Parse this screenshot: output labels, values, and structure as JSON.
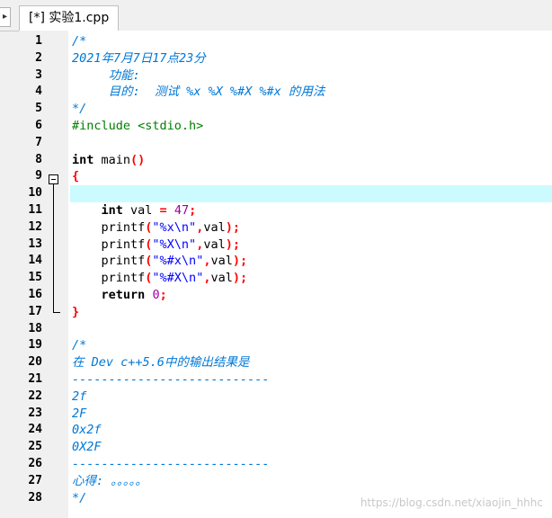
{
  "tab": {
    "scroll_left_icon": "arrow-right-icon",
    "title": "[*] 实验1.cpp"
  },
  "editor": {
    "active_line": 10,
    "lines": [
      {
        "n": "1",
        "segs": [
          {
            "t": "/*",
            "c": "comment"
          }
        ]
      },
      {
        "n": "2",
        "segs": [
          {
            "t": "2021年7月7日17点23分",
            "c": "comment"
          }
        ]
      },
      {
        "n": "3",
        "segs": [
          {
            "t": "     功能:",
            "c": "comment"
          }
        ]
      },
      {
        "n": "4",
        "segs": [
          {
            "t": "     目的:  测试 %x %X %#X %#x 的用法",
            "c": "comment"
          }
        ]
      },
      {
        "n": "5",
        "segs": [
          {
            "t": "*/",
            "c": "comment"
          }
        ]
      },
      {
        "n": "6",
        "segs": [
          {
            "t": "#include <stdio.h>",
            "c": "pre"
          }
        ]
      },
      {
        "n": "7",
        "segs": []
      },
      {
        "n": "8",
        "segs": [
          {
            "t": "int",
            "c": "kw"
          },
          {
            "t": " main",
            "c": "plain"
          },
          {
            "t": "()",
            "c": "sym"
          }
        ]
      },
      {
        "n": "9",
        "segs": [
          {
            "t": "{",
            "c": "sym"
          }
        ]
      },
      {
        "n": "10",
        "segs": []
      },
      {
        "n": "11",
        "segs": [
          {
            "t": "    ",
            "c": "plain"
          },
          {
            "t": "int",
            "c": "kw"
          },
          {
            "t": " val ",
            "c": "plain"
          },
          {
            "t": "=",
            "c": "sym"
          },
          {
            "t": " ",
            "c": "plain"
          },
          {
            "t": "47",
            "c": "num"
          },
          {
            "t": ";",
            "c": "sym"
          }
        ]
      },
      {
        "n": "12",
        "segs": [
          {
            "t": "    printf",
            "c": "plain"
          },
          {
            "t": "(",
            "c": "sym"
          },
          {
            "t": "\"%x\\n\"",
            "c": "str"
          },
          {
            "t": ",",
            "c": "sym"
          },
          {
            "t": "val",
            "c": "plain"
          },
          {
            "t": ");",
            "c": "sym"
          }
        ]
      },
      {
        "n": "13",
        "segs": [
          {
            "t": "    printf",
            "c": "plain"
          },
          {
            "t": "(",
            "c": "sym"
          },
          {
            "t": "\"%X\\n\"",
            "c": "str"
          },
          {
            "t": ",",
            "c": "sym"
          },
          {
            "t": "val",
            "c": "plain"
          },
          {
            "t": ");",
            "c": "sym"
          }
        ]
      },
      {
        "n": "14",
        "segs": [
          {
            "t": "    printf",
            "c": "plain"
          },
          {
            "t": "(",
            "c": "sym"
          },
          {
            "t": "\"%#x\\n\"",
            "c": "str"
          },
          {
            "t": ",",
            "c": "sym"
          },
          {
            "t": "val",
            "c": "plain"
          },
          {
            "t": ");",
            "c": "sym"
          }
        ]
      },
      {
        "n": "15",
        "segs": [
          {
            "t": "    printf",
            "c": "plain"
          },
          {
            "t": "(",
            "c": "sym"
          },
          {
            "t": "\"%#X\\n\"",
            "c": "str"
          },
          {
            "t": ",",
            "c": "sym"
          },
          {
            "t": "val",
            "c": "plain"
          },
          {
            "t": ");",
            "c": "sym"
          }
        ]
      },
      {
        "n": "16",
        "segs": [
          {
            "t": "    ",
            "c": "plain"
          },
          {
            "t": "return",
            "c": "kw"
          },
          {
            "t": " ",
            "c": "plain"
          },
          {
            "t": "0",
            "c": "num"
          },
          {
            "t": ";",
            "c": "sym"
          }
        ]
      },
      {
        "n": "17",
        "segs": [
          {
            "t": "}",
            "c": "sym"
          }
        ]
      },
      {
        "n": "18",
        "segs": []
      },
      {
        "n": "19",
        "segs": [
          {
            "t": "/*",
            "c": "comment"
          }
        ]
      },
      {
        "n": "20",
        "segs": [
          {
            "t": "在 Dev c++5.6中的输出结果是",
            "c": "comment"
          }
        ]
      },
      {
        "n": "21",
        "segs": [
          {
            "t": "---------------------------",
            "c": "comment"
          }
        ]
      },
      {
        "n": "22",
        "segs": [
          {
            "t": "2f",
            "c": "comment"
          }
        ]
      },
      {
        "n": "23",
        "segs": [
          {
            "t": "2F",
            "c": "comment"
          }
        ]
      },
      {
        "n": "24",
        "segs": [
          {
            "t": "0x2f",
            "c": "comment"
          }
        ]
      },
      {
        "n": "25",
        "segs": [
          {
            "t": "0X2F",
            "c": "comment"
          }
        ]
      },
      {
        "n": "26",
        "segs": [
          {
            "t": "---------------------------",
            "c": "comment"
          }
        ]
      },
      {
        "n": "27",
        "segs": [
          {
            "t": "心得: 。。。。。",
            "c": "comment"
          }
        ]
      },
      {
        "n": "28",
        "segs": [
          {
            "t": "*/",
            "c": "comment"
          }
        ]
      }
    ]
  },
  "watermark": "https://blog.csdn.net/xiaojin_hhhc"
}
